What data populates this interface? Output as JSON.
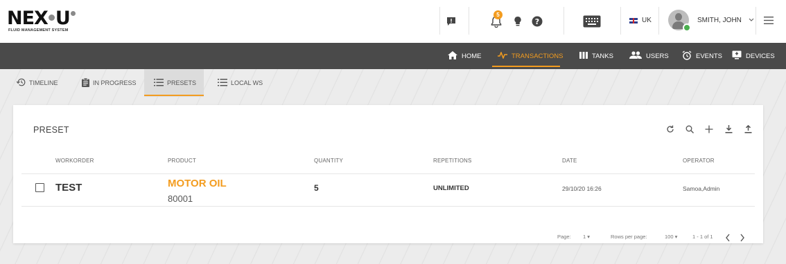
{
  "brand": {
    "logo_text": "NEX·U·",
    "logo_subtitle": "FLUID MANAGEMENT SYSTEM"
  },
  "header": {
    "notification_count": "5",
    "language": "UK",
    "user_name": "SMITH, JOHN",
    "icons": [
      "chat-icon",
      "bell-icon",
      "lightbulb-icon",
      "help-icon",
      "keyboard-icon",
      "flag-icon",
      "avatar",
      "menu-icon"
    ]
  },
  "nav": {
    "items": [
      {
        "label": "HOME",
        "icon": "home-icon"
      },
      {
        "label": "TRANSACTIONS",
        "icon": "pulse-icon",
        "active": true
      },
      {
        "label": "TANKS",
        "icon": "tanks-icon"
      },
      {
        "label": "USERS",
        "icon": "users-icon"
      },
      {
        "label": "EVENTS",
        "icon": "alarm-icon"
      },
      {
        "label": "DEVICES",
        "icon": "device-icon"
      }
    ]
  },
  "subtabs": [
    {
      "label": "TIMELINE",
      "icon": "history-icon"
    },
    {
      "label": "IN PROGRESS",
      "icon": "clipboard-icon"
    },
    {
      "label": "PRESETS",
      "icon": "list-icon",
      "active": true
    },
    {
      "label": "LOCAL WS",
      "icon": "list-icon"
    }
  ],
  "card": {
    "title": "PRESET",
    "tools": [
      "refresh-icon",
      "search-icon",
      "add-icon",
      "download-icon",
      "upload-icon"
    ],
    "columns": [
      "WORKORDER",
      "PRODUCT",
      "QUANTITY",
      "REPETITIONS",
      "DATE",
      "OPERATOR"
    ],
    "rows": [
      {
        "workorder": "TEST",
        "product": "MOTOR OIL",
        "product_code": "80001",
        "quantity": "5",
        "repetitions": "UNLIMITED",
        "date": "29/10/20 16:26",
        "operator": "Samoa,Admin"
      }
    ],
    "footer": {
      "page_label": "Page:",
      "page_value": "1",
      "rows_label": "Rows per page:",
      "rows_value": "100",
      "range": "1 - 1 of 1"
    }
  },
  "colors": {
    "accent": "#f39c1f",
    "navbar": "#4a4a4a",
    "status_online": "#4caf50"
  }
}
